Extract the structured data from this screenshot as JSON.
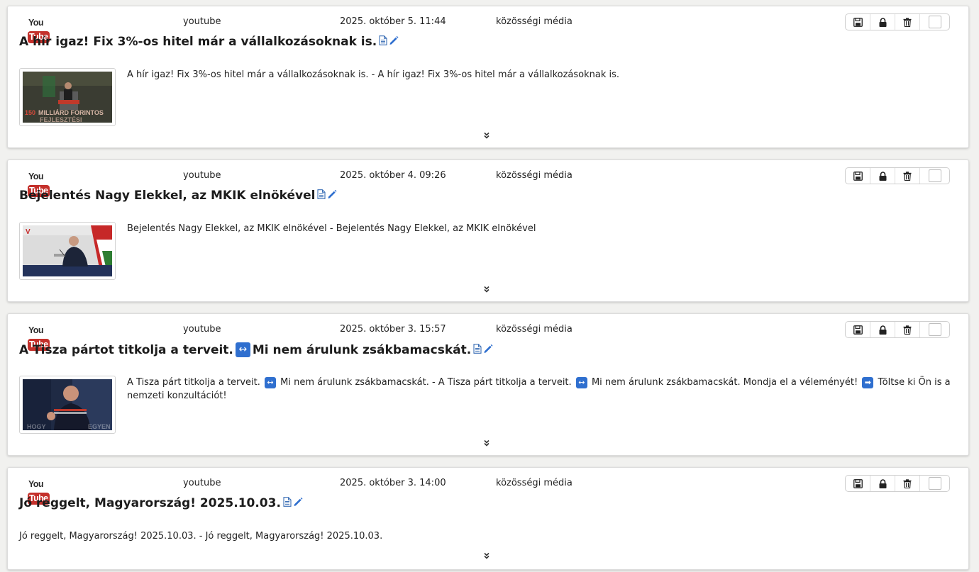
{
  "posts": [
    {
      "platform_icon": "youtube-logo",
      "logo_text_you": "You",
      "logo_text_tube": "Tube",
      "source": "youtube",
      "date": "2025. október 5. 11:44",
      "category": "közösségi média",
      "title": "A hír igaz! Fix 3%-os hitel már a vállalkozásoknak is.",
      "description": "A hír igaz! Fix 3%-os hitel már a vállalkozásoknak is. - A hír igaz! Fix 3%-os hitel már a vállalkozásoknak is.",
      "thumbnail_overlay_text": "150 MILLIÁRD FORINTOS FEJLESZTÉSI",
      "thumbnail_colors": {
        "bg": "#3a3c32",
        "accent": "#c0392b"
      }
    },
    {
      "platform_icon": "youtube-logo",
      "logo_text_you": "You",
      "logo_text_tube": "Tube",
      "source": "youtube",
      "date": "2025. október 4. 09:26",
      "category": "közösségi média",
      "title": "Bejelentés Nagy Elekkel, az MKIK elnökével",
      "description": "Bejelentés Nagy Elekkel, az MKIK elnökével - Bejelentés Nagy Elekkel, az MKIK elnökével",
      "thumbnail_overlay_text": "",
      "thumbnail_colors": {
        "bg": "#d9d9d9",
        "accent": "#2e6b3a"
      }
    },
    {
      "platform_icon": "youtube-logo",
      "logo_text_you": "You",
      "logo_text_tube": "Tube",
      "source": "youtube",
      "date": "2025. október 3. 15:57",
      "category": "közösségi média",
      "title_before": "A Tisza pártot titkolja a terveit.",
      "title_emoji": "↔",
      "title_after": "Mi nem árulunk zsákbamacskát.",
      "desc_part1": "A Tisza párt titkolja a terveit.",
      "desc_emoji1": "↔",
      "desc_part2": "Mi nem árulunk zsákbamacskát. - A Tisza párt titkolja a terveit.",
      "desc_emoji2": "↔",
      "desc_part3": "Mi nem árulunk zsákbamacskát. Mondja el a véleményét!",
      "desc_emoji3": "➡",
      "desc_part4": "Töltse ki Ön is a nemzeti konzultációt!",
      "thumbnail_overlay_text": "HOGY NEGYEN",
      "thumbnail_colors": {
        "bg": "#1f2a44",
        "accent": "#c0392b"
      }
    },
    {
      "platform_icon": "youtube-logo",
      "logo_text_you": "You",
      "logo_text_tube": "Tube",
      "source": "youtube",
      "date": "2025. október 3. 14:00",
      "category": "közösségi média",
      "title": "Jó reggelt, Magyarország! 2025.10.03.",
      "description": "Jó reggelt, Magyarország! 2025.10.03. - Jó reggelt, Magyarország! 2025.10.03."
    }
  ],
  "toolbar_icons": [
    "save-icon",
    "lock-icon",
    "trash-icon",
    "select-checkbox"
  ],
  "title_icons": [
    "document-icon",
    "edit-pencil-icon"
  ],
  "expand_icon": "double-chevron-down-icon"
}
